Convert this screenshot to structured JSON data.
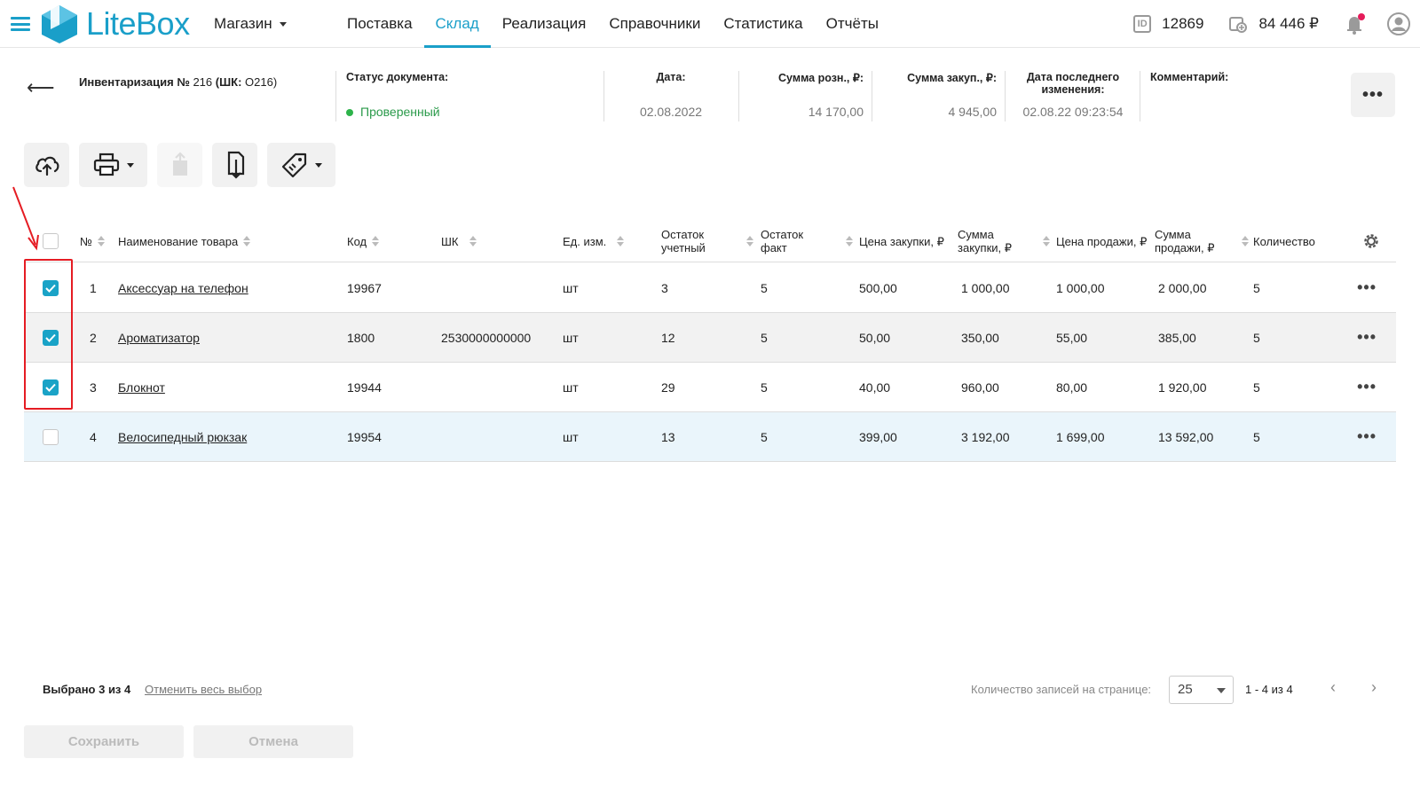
{
  "nav": {
    "brand": "LiteBox",
    "store": "Магазин",
    "menu": [
      "Поставка",
      "Склад",
      "Реализация",
      "Справочники",
      "Статистика",
      "Отчёты"
    ],
    "active_menu": "Склад",
    "user_id": "12869",
    "balance": "84 446 ₽",
    "colors": {
      "accent": "#1a9fc9",
      "notify": "#e51c5a"
    }
  },
  "doc": {
    "title_bold": "Инвентаризация №",
    "title_num": " 216 ",
    "title_bc_bold": "(ШК:",
    "title_bc": " О216)",
    "status_label": "Статус документа:",
    "status_value": "Проверенный",
    "date_label": "Дата:",
    "date_value": "02.08.2022",
    "retail_label": "Сумма розн., ₽:",
    "retail_value": "14 170,00",
    "purchase_label": "Сумма закуп., ₽:",
    "purchase_value": "4 945,00",
    "lastmod_label": "Дата последнего изменения:",
    "lastmod_value": "02.08.22 09:23:54",
    "comment_label": "Комментарий:",
    "more_label": "•••"
  },
  "table": {
    "headers": {
      "num": "№",
      "name": "Наименование товара",
      "code": "Код",
      "barcode": "ШК",
      "unit": "Ед. изм.",
      "stock_acc": "Остаток учетный",
      "stock_fact": "Остаток факт",
      "price_buy": "Цена закупки, ₽",
      "sum_buy": "Сумма закупки, ₽",
      "price_sell": "Цена продажи, ₽",
      "sum_sell": "Сумма продажи, ₽",
      "qty": "Количество"
    },
    "rows": [
      {
        "checked": true,
        "num": "1",
        "name": "Аксессуар на телефон",
        "code": "19967",
        "barcode": "",
        "unit": "шт",
        "stock_acc": "3",
        "stock_fact": "5",
        "price_buy": "500,00",
        "sum_buy": "1 000,00",
        "price_sell": "1 000,00",
        "sum_sell": "2 000,00",
        "qty": "5",
        "more": "•••"
      },
      {
        "checked": true,
        "num": "2",
        "name": "Ароматизатор",
        "code": "1800",
        "barcode": "2530000000000",
        "unit": "шт",
        "stock_acc": "12",
        "stock_fact": "5",
        "price_buy": "50,00",
        "sum_buy": "350,00",
        "price_sell": "55,00",
        "sum_sell": "385,00",
        "qty": "5",
        "more": "•••"
      },
      {
        "checked": true,
        "num": "3",
        "name": "Блокнот",
        "code": "19944",
        "barcode": "",
        "unit": "шт",
        "stock_acc": "29",
        "stock_fact": "5",
        "price_buy": "40,00",
        "sum_buy": "960,00",
        "price_sell": "80,00",
        "sum_sell": "1 920,00",
        "qty": "5",
        "more": "•••"
      },
      {
        "checked": false,
        "num": "4",
        "name": "Велосипедный рюкзак",
        "code": "19954",
        "barcode": "",
        "unit": "шт",
        "stock_acc": "13",
        "stock_fact": "5",
        "price_buy": "399,00",
        "sum_buy": "3 192,00",
        "price_sell": "1 699,00",
        "sum_sell": "13 592,00",
        "qty": "5",
        "more": "•••"
      }
    ]
  },
  "footer": {
    "selected_bold": "Выбрано 3 из 4",
    "cancel_selection": "Отменить весь выбор",
    "per_page_label": "Количество записей на странице:",
    "per_page_value": "25",
    "range": "1 - 4 из 4",
    "prev": "‹",
    "next": "›",
    "save": "Сохранить",
    "cancel": "Отмена"
  }
}
